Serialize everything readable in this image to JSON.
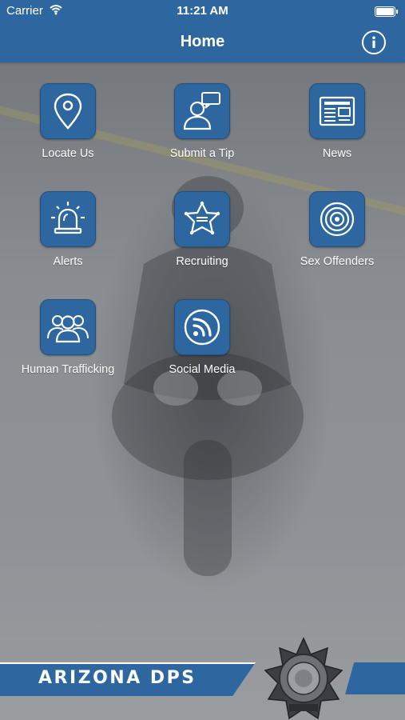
{
  "status_bar": {
    "carrier": "Carrier",
    "time": "11:21 AM"
  },
  "nav": {
    "title": "Home"
  },
  "tiles": [
    {
      "label": "Locate Us",
      "icon": "location-pin-icon"
    },
    {
      "label": "Submit a Tip",
      "icon": "chat-person-icon"
    },
    {
      "label": "News",
      "icon": "newspaper-icon"
    },
    {
      "label": "Alerts",
      "icon": "siren-icon"
    },
    {
      "label": "Recruiting",
      "icon": "sheriff-star-icon"
    },
    {
      "label": "Sex Offenders",
      "icon": "target-icon"
    },
    {
      "label": "Human Trafficking",
      "icon": "group-people-icon"
    },
    {
      "label": "Social Media",
      "icon": "rss-icon"
    }
  ],
  "footer": {
    "banner_text": "ARIZONA DPS"
  },
  "colors": {
    "brand_blue": "#2e67a0",
    "text": "#ffffff"
  }
}
